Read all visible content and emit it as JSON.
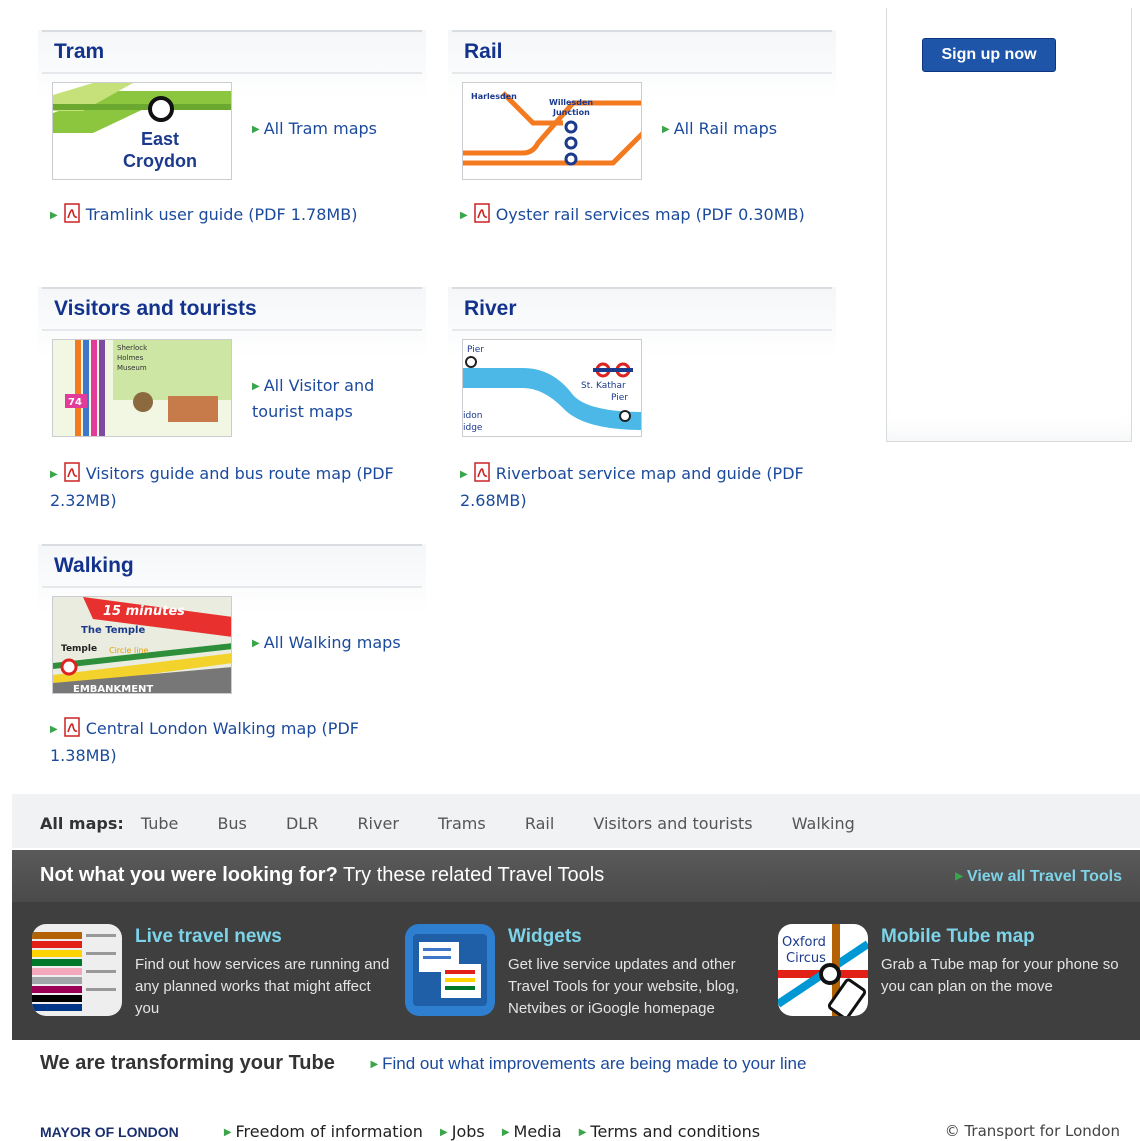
{
  "cards": {
    "tram": {
      "title": "Tram",
      "all": "All Tram maps",
      "pdf": "Tramlink user guide (PDF 1.78MB)",
      "thumb_text": [
        "East",
        "Croydon"
      ]
    },
    "rail": {
      "title": "Rail",
      "all": "All Rail maps",
      "pdf": "Oyster rail services map (PDF 0.30MB)",
      "thumb_text": [
        "Harlesden",
        "Willesden",
        "Junction"
      ]
    },
    "visitors": {
      "title": "Visitors and tourists",
      "all": "All Visitor and tourist maps",
      "pdf": "Visitors guide and bus route map (PDF 2.32MB)",
      "thumb_text": [
        "Sherlock",
        "Holmes",
        "Museum",
        "74"
      ]
    },
    "river": {
      "title": "River",
      "all": "",
      "pdf": "Riverboat service map and guide (PDF 2.68MB)",
      "thumb_text": [
        "Pier",
        "St. Kathar",
        "Pier",
        "idon",
        "idge"
      ]
    },
    "walking": {
      "title": "Walking",
      "all": "All Walking maps",
      "pdf": "Central London Walking map (PDF 1.38MB)",
      "thumb_text": [
        "15 minutes",
        "The Temple",
        "Temple",
        "Circle line",
        "EMBANKMENT"
      ]
    }
  },
  "signup": {
    "label": "Sign up now"
  },
  "all_maps": {
    "label": "All maps:",
    "items": [
      "Tube",
      "Bus",
      "DLR",
      "River",
      "Trams",
      "Rail",
      "Visitors and tourists",
      "Walking"
    ]
  },
  "tools": {
    "heading_bold": "Not what you were looking for?",
    "heading_rest": "Try these related Travel Tools",
    "view_all": "View all Travel Tools",
    "items": [
      {
        "title": "Live travel news",
        "desc": "Find out how services are running and any planned works that might affect you"
      },
      {
        "title": "Widgets",
        "desc": "Get live service updates and other Travel Tools for your website, blog, Netvibes or iGoogle homepage"
      },
      {
        "title": "Mobile Tube map",
        "desc": "Grab a Tube map for your phone so you can plan on the move",
        "icon_text": [
          "Oxford",
          "Circus"
        ]
      }
    ]
  },
  "transform": {
    "title": "We are transforming your Tube",
    "link": "Find out what improvements are being made to your line"
  },
  "footer": {
    "mayor": "MAYOR OF LONDON",
    "links": [
      "Freedom of information",
      "Jobs",
      "Media",
      "Terms and conditions"
    ],
    "copyright": "© Transport for London"
  },
  "colors": {
    "link": "#1b4a9c",
    "heading": "#12328c",
    "accent": "#7dd3e8",
    "arrow": "#3aa54a",
    "button": "#1e55a8"
  }
}
